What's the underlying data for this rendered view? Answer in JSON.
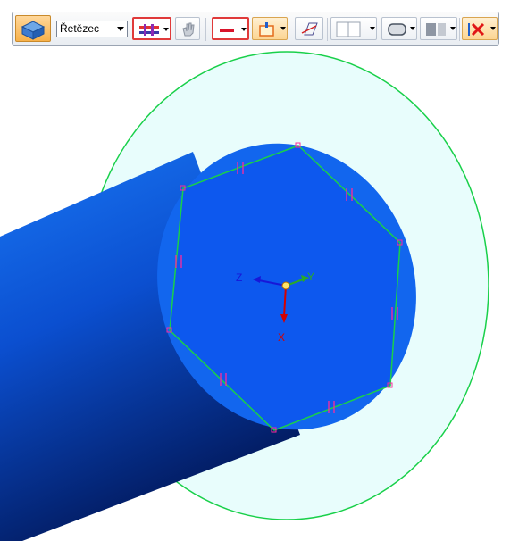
{
  "toolbar": {
    "mode_icon": "part-view-icon",
    "selection_filter": {
      "value": "Řetězec",
      "options_visible": false
    },
    "buttons": [
      {
        "name": "relations-toggle",
        "icon": "relations-icon",
        "highlighted": true
      },
      {
        "name": "hand-tool",
        "icon": "pan-hand-icon",
        "highlighted": false
      },
      {
        "name": "line-style",
        "icon": "line-style-icon",
        "highlighted": true
      },
      {
        "name": "sketch-plane",
        "icon": "sketch-plane-icon",
        "highlighted": false
      },
      {
        "name": "view-normal",
        "icon": "view-normal-icon",
        "highlighted": false
      },
      {
        "name": "layout",
        "icon": "layout-icon",
        "highlighted": false
      },
      {
        "name": "shape",
        "icon": "shape-icon",
        "highlighted": false
      },
      {
        "name": "display",
        "icon": "display-icon",
        "highlighted": false
      },
      {
        "name": "delete",
        "icon": "delete-x-icon",
        "highlighted": false
      }
    ]
  },
  "viewport": {
    "axis_labels": {
      "x": "X",
      "y": "Y",
      "z": "Z"
    },
    "colors": {
      "sketch_line": "#19d04a",
      "relation_marker": "#ff2a9a",
      "disk_fill": "#e8fdfc",
      "cylinder_face": "#1468f0",
      "hex_face": "#0d57ec",
      "axis_x": "#d40000",
      "axis_y": "#2aa82a",
      "axis_z": "#1717d8"
    }
  }
}
